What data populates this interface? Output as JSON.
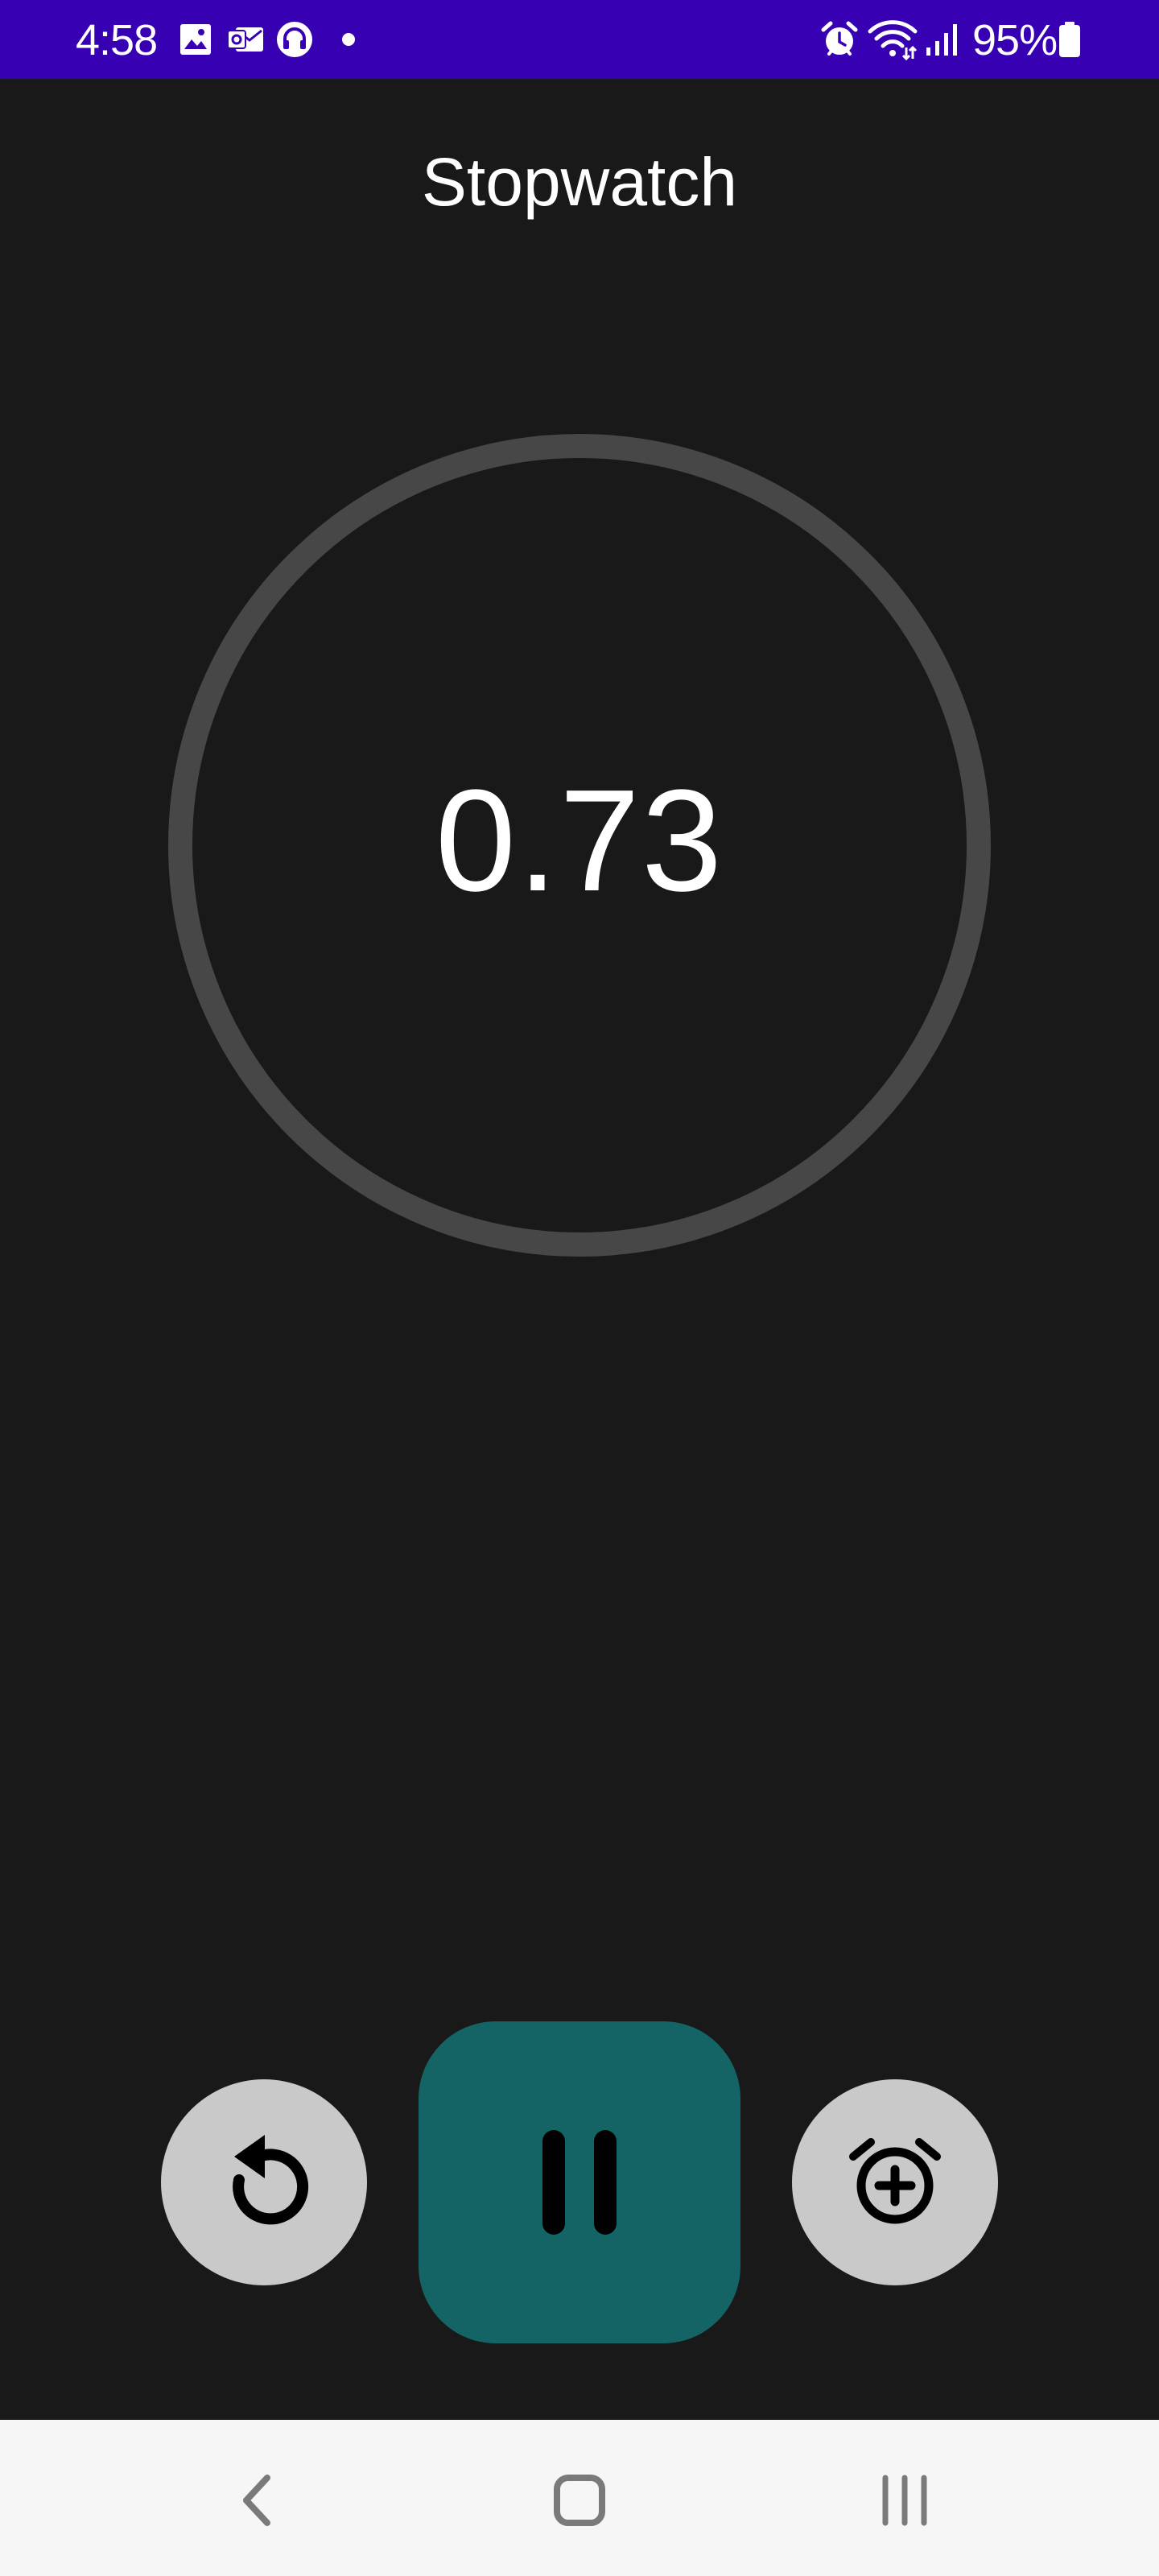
{
  "status_bar": {
    "time": "4:58",
    "battery": "95%",
    "left_icons": [
      "gallery-icon",
      "outlook-icon",
      "headset-app-icon",
      "notification-dot-icon"
    ],
    "right_icons": [
      "alarm-icon",
      "wifi-icon",
      "signal-icon",
      "battery-icon"
    ],
    "color": "#3700b3"
  },
  "header": {
    "title": "Stopwatch"
  },
  "timer": {
    "elapsed": "0.73",
    "ring_color": "#474747"
  },
  "controls": {
    "reset_icon": "reset-icon",
    "pause_icon": "pause-icon",
    "lap_icon": "add-alarm-icon",
    "primary_color": "#156465",
    "secondary_color": "#c9c9c9"
  },
  "nav_bar": {
    "icons": [
      "back-icon",
      "home-icon",
      "recents-icon"
    ]
  },
  "colors": {
    "background": "#191919",
    "text": "#ffffff"
  }
}
